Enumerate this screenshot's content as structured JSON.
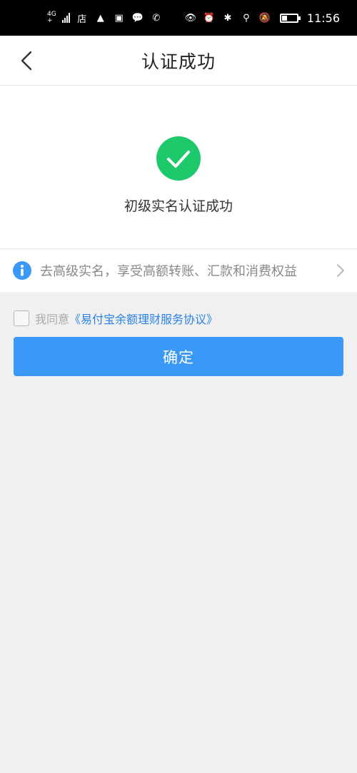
{
  "status_bar": {
    "network": "4G",
    "network_sub": "+",
    "app_icons": [
      "店",
      "▲",
      "▣",
      "💬",
      "✆"
    ],
    "right_icons": [
      "👁",
      "⏰",
      "✱",
      "⚲",
      "🔕"
    ],
    "battery_level": 0.35,
    "time": "11:56"
  },
  "header": {
    "title": "认证成功"
  },
  "success": {
    "message": "初级实名认证成功",
    "icon_color": "#1dc96b"
  },
  "upgrade": {
    "text": "去高级实名，享受高额转账、汇款和消费权益"
  },
  "agreement": {
    "prefix": "我同意",
    "link": "《易付宝余额理财服务协议》",
    "checked": false
  },
  "confirm_button": {
    "label": "确定"
  },
  "colors": {
    "accent": "#3a98f7",
    "link": "#2a82e4",
    "success": "#1dc96b",
    "info": "#3a98f7"
  }
}
